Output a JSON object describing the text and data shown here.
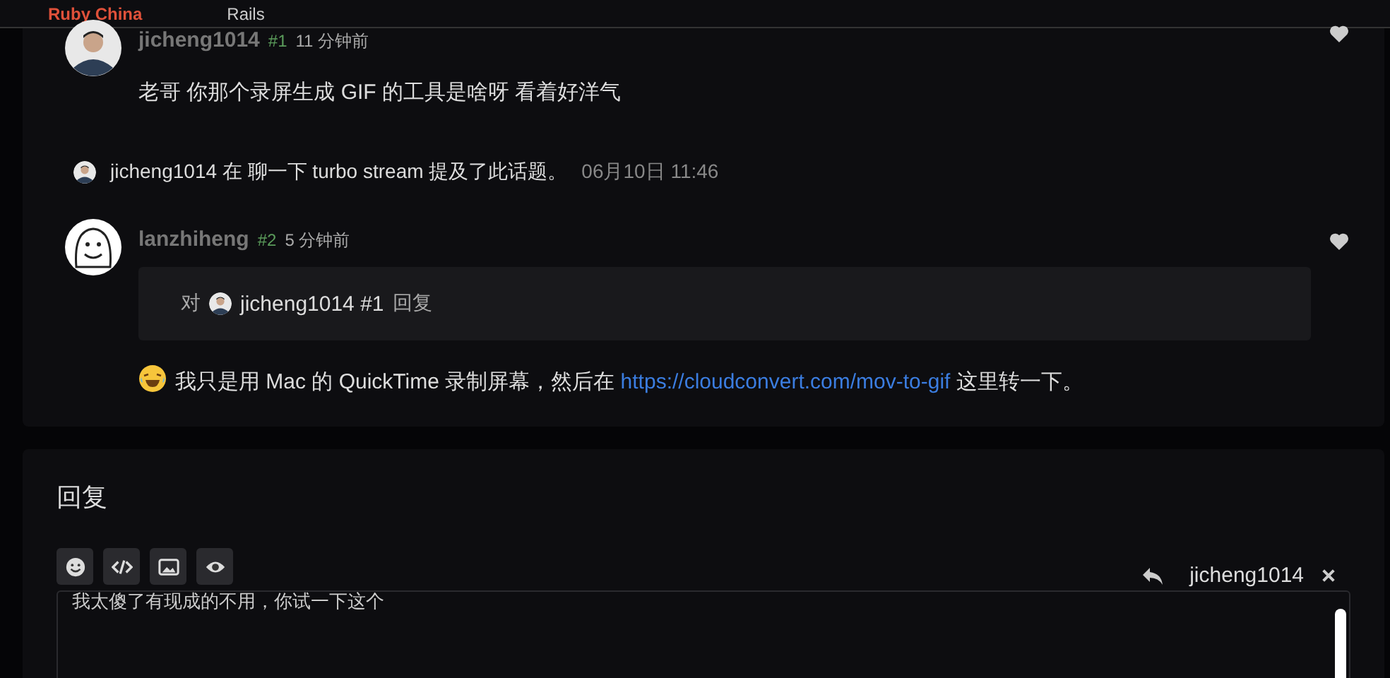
{
  "navbar": {
    "brand": "Ruby China",
    "topic": "Rails"
  },
  "replies": [
    {
      "author": "jicheng1014",
      "floor": "#1",
      "time": "11 分钟前",
      "liked": false,
      "body": "老哥 你那个录屏生成 GIF 的工具是啥呀 看着好洋气"
    },
    {
      "author": "lanzhiheng",
      "floor": "#2",
      "time": "5 分钟前",
      "liked": false,
      "quote": {
        "prefix": "对",
        "user": "jicheng1014",
        "floor": "#1",
        "suffix": "回复"
      },
      "body_before": "我只是用 Mac 的 QuickTime 录制屏幕，然后在",
      "link": "https://cloudconvert.com/mov-to-gif",
      "body_after": "这里转一下。"
    }
  ],
  "mention": {
    "user": "jicheng1014",
    "text": "在 聊一下 turbo stream 提及了此话题。",
    "time": "06月10日 11:46"
  },
  "reply_form": {
    "title": "回复",
    "tools": [
      {
        "kind": "emoji"
      },
      {
        "kind": "code"
      },
      {
        "kind": "image"
      },
      {
        "kind": "preview"
      }
    ],
    "reply_to": "jicheng1014",
    "value": "我太傻了有现成的不用，你试一下这个"
  }
}
